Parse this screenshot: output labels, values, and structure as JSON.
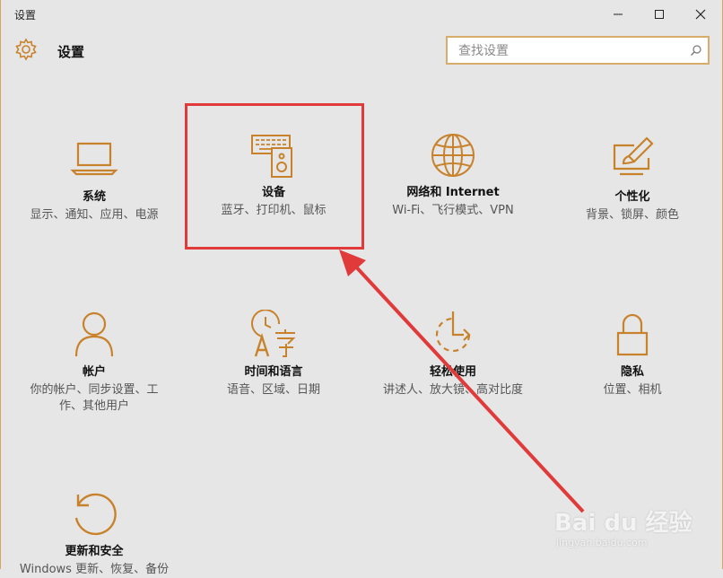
{
  "window": {
    "title": "设置",
    "minimize_label": "minimize",
    "maximize_label": "maximize",
    "close_label": "close"
  },
  "header": {
    "title": "设置",
    "search": {
      "placeholder": "查找设置",
      "value": ""
    }
  },
  "colors": {
    "accent": "#c8822b",
    "highlight": "#e03a3a"
  },
  "tiles": [
    {
      "name": "系统",
      "desc": "显示、通知、应用、电源",
      "icon": "laptop-icon"
    },
    {
      "name": "设备",
      "desc": "蓝牙、打印机、鼠标",
      "icon": "devices-icon"
    },
    {
      "name": "网络和 Internet",
      "desc": "Wi-Fi、飞行模式、VPN",
      "icon": "globe-icon"
    },
    {
      "name": "个性化",
      "desc": "背景、锁屏、颜色",
      "icon": "personalization-icon"
    },
    {
      "name": "帐户",
      "desc": "你的帐户、同步设置、工作、其他用户",
      "icon": "person-icon"
    },
    {
      "name": "时间和语言",
      "desc": "语音、区域、日期",
      "icon": "time-language-icon"
    },
    {
      "name": "轻松使用",
      "desc": "讲述人、放大镜、高对比度",
      "icon": "ease-of-access-icon"
    },
    {
      "name": "隐私",
      "desc": "位置、相机",
      "icon": "lock-icon"
    },
    {
      "name": "更新和安全",
      "desc": "Windows 更新、恢复、备份",
      "icon": "update-icon"
    }
  ],
  "watermark": {
    "brand": "Bai du 经验",
    "site": "jingyan.baidu.com"
  }
}
